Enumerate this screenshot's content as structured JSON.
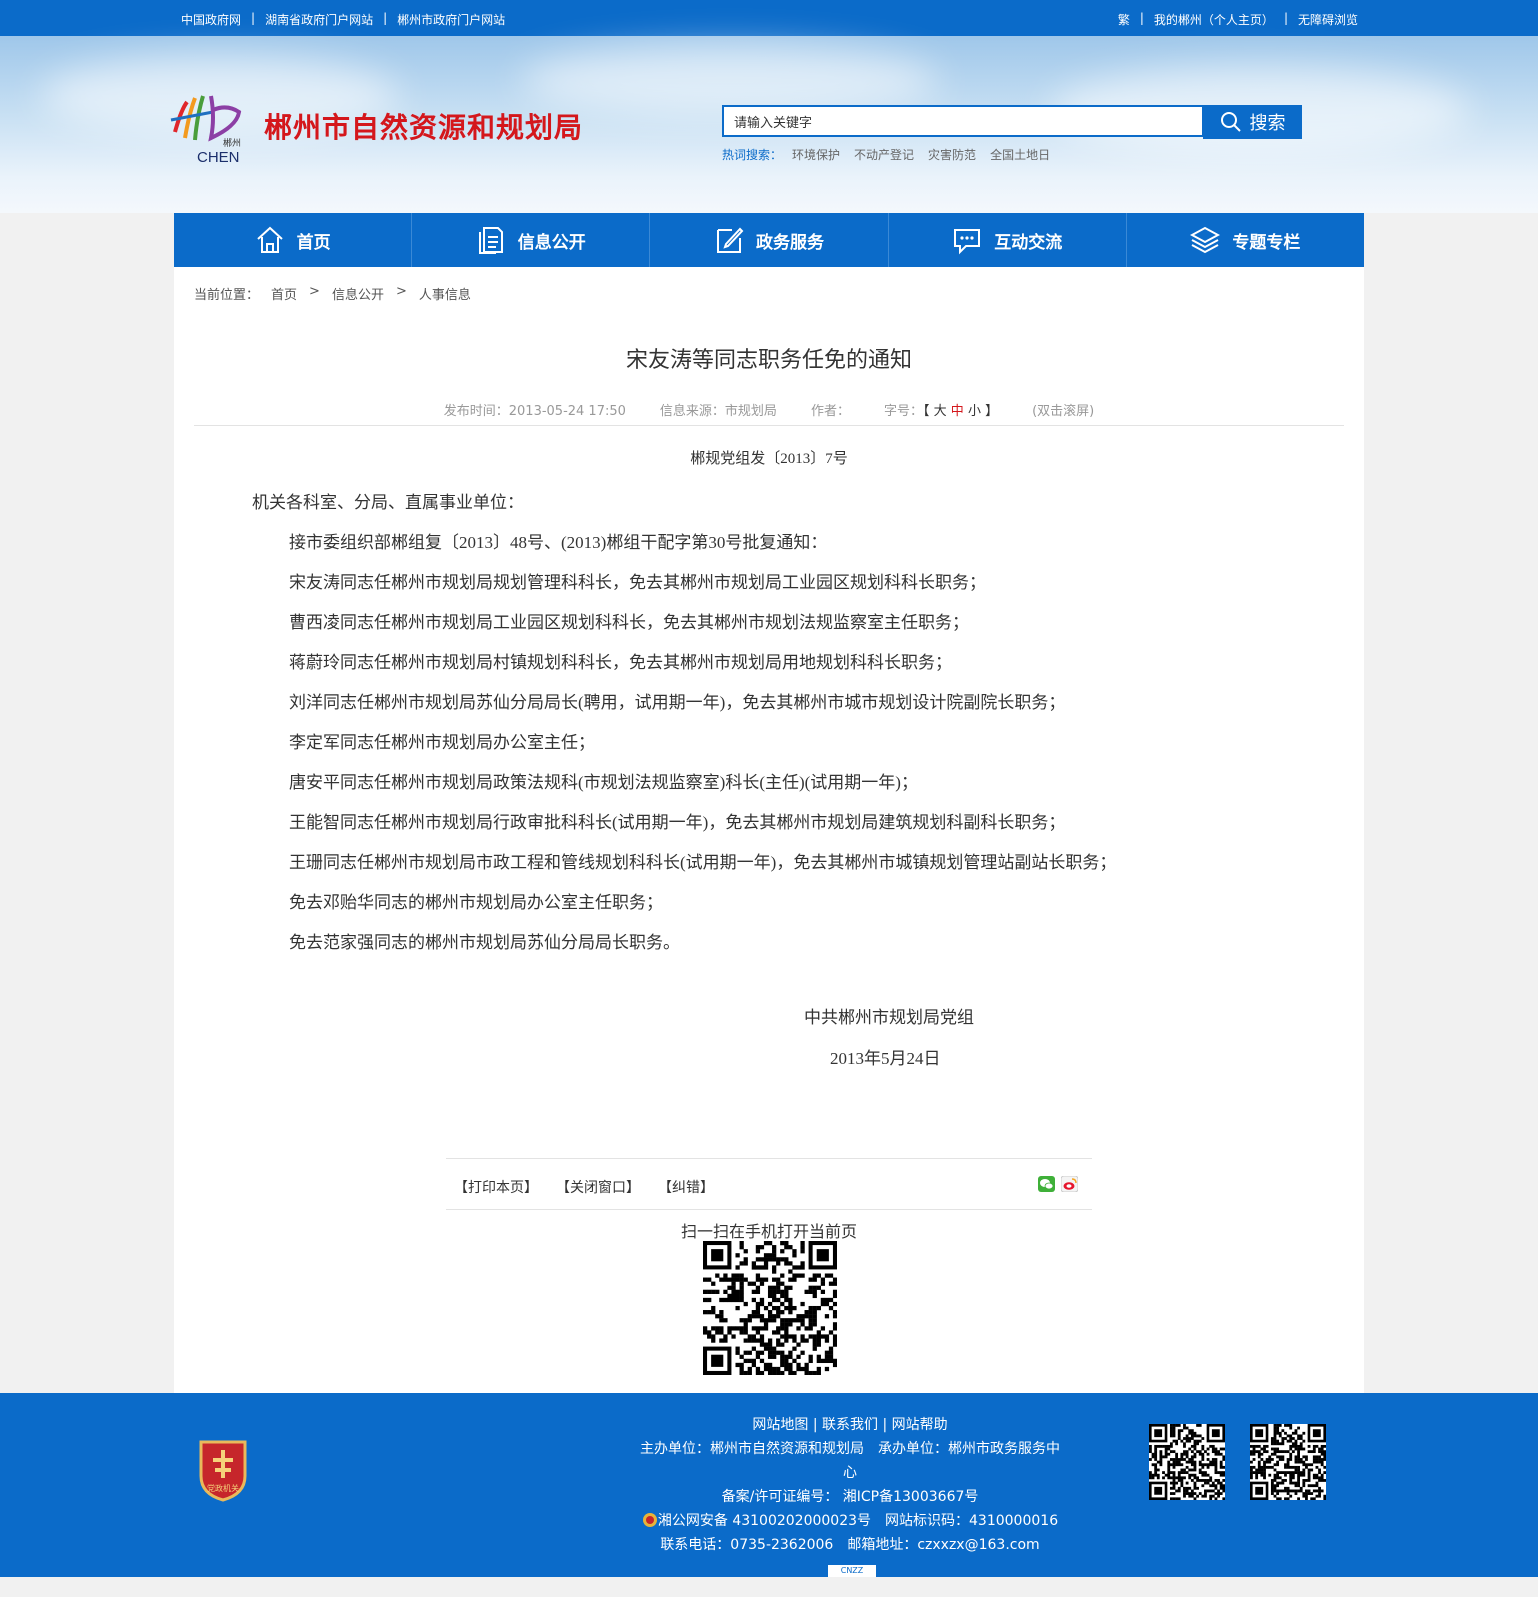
{
  "topbar": {
    "left_links": [
      "中国政府网",
      "湖南省政府门户网站",
      "郴州市政府门户网站"
    ],
    "right_links": [
      "繁",
      "我的郴州（个人主页）",
      "无障碍浏览"
    ],
    "separator": "|"
  },
  "header": {
    "logo_text": "郴州",
    "logo_sub": "CHEN",
    "site_title": "郴州市自然资源和规划局",
    "search_placeholder": "请输入关键字",
    "search_button": "搜索",
    "hot_label": "热词搜索：",
    "hot_words": [
      "环境保护",
      "不动产登记",
      "灾害防范",
      "全国土地日"
    ]
  },
  "nav": {
    "items": [
      {
        "label": "首页",
        "icon": "home-icon"
      },
      {
        "label": "信息公开",
        "icon": "document-icon"
      },
      {
        "label": "政务服务",
        "icon": "edit-icon"
      },
      {
        "label": "互动交流",
        "icon": "chat-icon"
      },
      {
        "label": "专题专栏",
        "icon": "layers-icon"
      }
    ]
  },
  "breadcrumb": {
    "label": "当前位置：",
    "items": [
      "首页",
      "信息公开",
      "人事信息"
    ],
    "separator": ">"
  },
  "article": {
    "title": "宋友涛等同志职务任免的通知",
    "publish_label": "发布时间：",
    "publish_time": "2013-05-24 17:50",
    "source_label": "信息来源：",
    "source": "市规划局",
    "author_label": "作者：",
    "font_label": "字号：",
    "font_open": "【",
    "font_large": "大",
    "font_medium": "中",
    "font_small": "小",
    "font_close": "】",
    "dblclick": "(双击滚屏)",
    "doc_no": "郴规党组发〔2013〕7号",
    "salutation": "机关各科室、分局、直属事业单位：",
    "paragraphs": [
      "接市委组织部郴组复〔2013〕48号、(2013)郴组干配字第30号批复通知：",
      "宋友涛同志任郴州市规划局规划管理科科长，免去其郴州市规划局工业园区规划科科长职务；",
      "曹西凌同志任郴州市规划局工业园区规划科科长，免去其郴州市规划法规监察室主任职务；",
      "蒋蔚玲同志任郴州市规划局村镇规划科科长，免去其郴州市规划局用地规划科科长职务；",
      "刘洋同志任郴州市规划局苏仙分局局长(聘用，试用期一年)，免去其郴州市城市规划设计院副院长职务；",
      "李定军同志任郴州市规划局办公室主任；",
      "唐安平同志任郴州市规划局政策法规科(市规划法规监察室)科长(主任)(试用期一年)；",
      "王能智同志任郴州市规划局行政审批科科长(试用期一年)，免去其郴州市规划局建筑规划科副科长职务；",
      "王珊同志任郴州市规划局市政工程和管线规划科科长(试用期一年)，免去其郴州市城镇规划管理站副站长职务；",
      "免去邓贻华同志的郴州市规划局办公室主任职务；",
      "免去范家强同志的郴州市规划局苏仙分局局长职务。"
    ],
    "signature": "中共郴州市规划局党组",
    "sign_date": "2013年5月24日"
  },
  "tools": {
    "print": "【打印本页】",
    "close": "【关闭窗口】",
    "correct": "【纠错】",
    "scan_text": "扫一扫在手机打开当前页"
  },
  "footer": {
    "badge_text": "党政机关",
    "links": [
      "网站地图",
      "联系我们",
      "网站帮助"
    ],
    "sponsor": "主办单位：郴州市自然资源和规划局　承办单位：郴州市政务服务中心",
    "icp": "备案/许可证编号： 湘ICP备13003667号",
    "police": "湘公网安备 43100202000023号　网站标识码：4310000016",
    "contact": "联系电话：0735-2362006　邮箱地址：czxxzx@163.com",
    "cnzz": "CNZZ"
  },
  "colors": {
    "primary_blue": "#0b6bc9",
    "title_red": "#d4171c"
  }
}
